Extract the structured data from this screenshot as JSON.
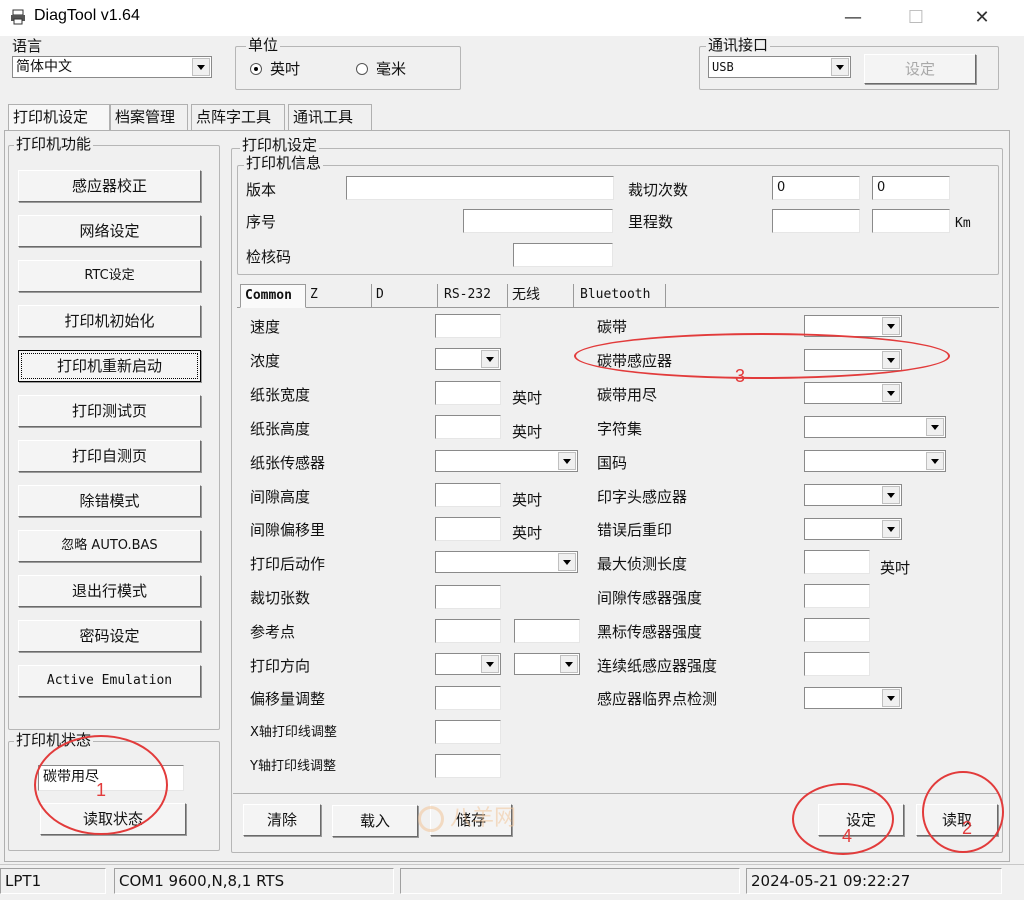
{
  "window": {
    "title": "DiagTool v1.64",
    "minimize": "—",
    "maximize": "☐",
    "close": "✕"
  },
  "language": {
    "label": "语言",
    "selected": "简体中文"
  },
  "unit": {
    "label": "单位",
    "options": [
      "英吋",
      "毫米"
    ],
    "selected_index": 0
  },
  "comm_port": {
    "label": "通讯接口",
    "selected": "USB",
    "set_button": "设定"
  },
  "tabs": [
    "打印机设定",
    "档案管理",
    "点阵字工具",
    "通讯工具"
  ],
  "active_tab": 0,
  "printer_functions": {
    "label": "打印机功能",
    "buttons": [
      "感应器校正",
      "网络设定",
      "RTC设定",
      "打印机初始化",
      "打印机重新启动",
      "打印测试页",
      "打印自测页",
      "除错模式",
      "忽略 AUTO.BAS",
      "退出行模式",
      "密码设定",
      "Active Emulation"
    ]
  },
  "printer_status": {
    "label": "打印机状态",
    "value": "碳带用尽",
    "read_button": "读取状态"
  },
  "printer_settings": {
    "label": "打印机设定"
  },
  "printer_info": {
    "label": "打印机信息",
    "version_label": "版本",
    "version_value": "",
    "serial_label": "序号",
    "serial_value": "",
    "checksum_label": "检核码",
    "checksum_value": "",
    "cut_count_label": "裁切次数",
    "cut_count_values": [
      "0",
      "0"
    ],
    "mileage_label": "里程数",
    "mileage_values": [
      "",
      ""
    ],
    "mileage_unit": "Km"
  },
  "subtabs": [
    "Common",
    "Z",
    "D",
    "RS-232",
    "无线",
    "Bluetooth"
  ],
  "common_left": {
    "speed": "速度",
    "density": "浓度",
    "paper_width": "纸张宽度",
    "paper_height": "纸张高度",
    "paper_sensor": "纸张传感器",
    "gap_height": "间隙高度",
    "gap_offset": "间隙偏移里",
    "post_print_action": "打印后动作",
    "cut_count": "裁切张数",
    "reference_point": "参考点",
    "print_direction": "打印方向",
    "offset_adjust": "偏移量调整",
    "x_axis_adjust": "X轴打印线调整",
    "y_axis_adjust": "Y轴打印线调整",
    "inch_unit": "英吋"
  },
  "common_right": {
    "ribbon": "碳带",
    "ribbon_sensor": "碳带感应器",
    "ribbon_end": "碳带用尽",
    "charset": "字符集",
    "country_code": "国码",
    "head_sensor": "印字头感应器",
    "reprint_after_error": "错误后重印",
    "max_detect_length": "最大侦测长度",
    "max_detect_unit": "英吋",
    "gap_sensor_strength": "间隙传感器强度",
    "black_mark_strength": "黑标传感器强度",
    "continuous_strength": "连续纸感应器强度",
    "threshold_detect": "感应器临界点检测"
  },
  "bottom_buttons": {
    "clear": "清除",
    "load": "载入",
    "save": "储存",
    "set": "设定",
    "read": "读取"
  },
  "annotations": [
    "1",
    "2",
    "3",
    "4"
  ],
  "watermark": "八羊网",
  "status_bar": {
    "port": "LPT1",
    "serial": "COM1 9600,N,8,1 RTS",
    "empty": "",
    "datetime": "2024-05-21 09:22:27"
  },
  "colors": {
    "annotation": "#e23b3b",
    "window_bg": "#f0f0f0"
  }
}
